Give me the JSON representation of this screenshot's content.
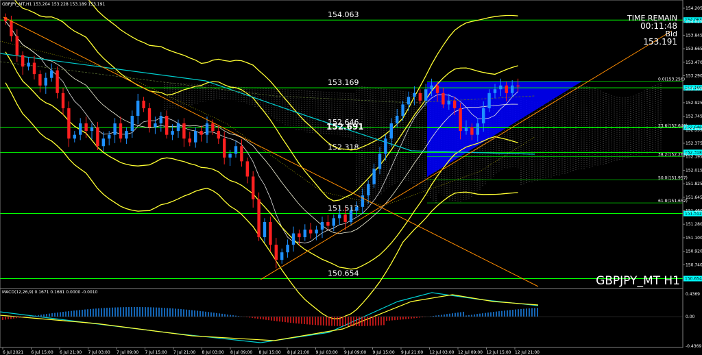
{
  "window": {
    "title": "GBPJPY_MT,H1 153.204 153.228 153.189 153.191",
    "symbol_label": "GBPJPY_MT H1"
  },
  "timer": {
    "label": "TIME REMAIN",
    "remaining": "00:11:48",
    "bid_label": "Bid",
    "bid": "153.191"
  },
  "price_axis": [
    "154.205",
    "154.025",
    "153.845",
    "153.665",
    "153.470",
    "153.290",
    "153.105",
    "152.925",
    "152.745",
    "152.555",
    "152.375",
    "152.195",
    "152.015",
    "151.825",
    "151.645",
    "151.460",
    "151.280",
    "151.100",
    "150.920",
    "150.740"
  ],
  "price_tags": [
    {
      "text": "154.063",
      "price": 154.063,
      "color": "#00ffff"
    },
    {
      "text": "153.169",
      "price": 153.169,
      "color": "#00ffff"
    },
    {
      "text": "152.646",
      "price": 152.646,
      "color": "#00ffff"
    },
    {
      "text": "152.318",
      "price": 152.318,
      "color": "#00ffff"
    },
    {
      "text": "151.512",
      "price": 151.512,
      "color": "#00ffff"
    },
    {
      "text": "150.654",
      "price": 150.654,
      "color": "#00ffff"
    }
  ],
  "levels": [
    {
      "text": "154.063",
      "price": 154.063,
      "color": "#00ff00"
    },
    {
      "text": "153.169",
      "price": 153.169,
      "color": "#00ff00"
    },
    {
      "text": "152.646",
      "price": 152.646,
      "color": "#00ff00"
    },
    {
      "text": "152.318",
      "price": 152.318,
      "color": "#00ff00"
    },
    {
      "text": "151.512",
      "price": 151.512,
      "color": "#00ff00"
    },
    {
      "text": "150.654",
      "price": 150.654,
      "color": "#00ff00"
    }
  ],
  "fibo": [
    {
      "text": "0.0(153.256)",
      "price": 153.256
    },
    {
      "text": "23.6(152.640)",
      "price": 152.64
    },
    {
      "text": "38.2(152.262)",
      "price": 152.262
    },
    {
      "text": "50.0(151.957)",
      "price": 151.957
    },
    {
      "text": "61.8(151.652)",
      "price": 151.652
    }
  ],
  "overlay_price": "152.691",
  "macd": {
    "header": "MACD(12,26,9) 0.1671 0.1681 0.0000 -0.0010",
    "axis": [
      "0.4369",
      "0.00",
      "-0.4369"
    ]
  },
  "time_axis": [
    "6 Jul 2021",
    "6 Jul 15:00",
    "6 Jul 21:00",
    "7 Jul 03:00",
    "7 Jul 09:00",
    "7 Jul 15:00",
    "7 Jul 21:00",
    "8 Jul 03:00",
    "8 Jul 09:00",
    "8 Jul 15:00",
    "8 Jul 21:00",
    "9 Jul 03:00",
    "9 Jul 09:00",
    "9 Jul 15:00",
    "9 Jul 21:00",
    "12 Jul 03:00",
    "12 Jul 09:00",
    "12 Jul 15:00",
    "12 Jul 21:00"
  ],
  "colors": {
    "bull": "#1e90ff",
    "bear": "#ff2020",
    "level": "#00ff00",
    "tag_bg": "#00ffff",
    "bands": "#ffff33",
    "trend": "#ff8c00",
    "ma": "#00cccc",
    "triangle": "#0000ff"
  },
  "chart_data": {
    "type": "candlestick",
    "symbol": "GBPJPY_MT",
    "timeframe": "H1",
    "ylim": [
      150.55,
      154.3
    ],
    "close_series": [
      154.05,
      153.85,
      153.6,
      153.45,
      153.5,
      153.35,
      153.2,
      153.3,
      153.4,
      153.1,
      152.9,
      152.5,
      152.55,
      152.7,
      152.6,
      152.65,
      152.4,
      152.5,
      152.55,
      152.7,
      152.5,
      152.6,
      152.8,
      153.0,
      152.9,
      152.65,
      152.7,
      152.8,
      152.55,
      152.6,
      152.7,
      152.5,
      152.45,
      152.6,
      152.55,
      152.7,
      152.6,
      152.5,
      152.25,
      152.3,
      152.4,
      152.2,
      152.0,
      151.7,
      151.2,
      151.4,
      151.1,
      150.9,
      151.0,
      151.1,
      151.25,
      151.2,
      151.3,
      151.25,
      151.3,
      151.4,
      151.35,
      151.45,
      151.5,
      151.4,
      151.55,
      151.6,
      151.75,
      151.9,
      152.1,
      152.3,
      152.5,
      152.7,
      152.8,
      152.95,
      153.05,
      153.1,
      153.0,
      153.15,
      153.2,
      153.1,
      152.95,
      153.0,
      152.9,
      152.6,
      152.65,
      152.55,
      152.7,
      152.9,
      153.1,
      153.15,
      153.2,
      153.1,
      153.2,
      153.19
    ],
    "levels": [
      154.063,
      153.169,
      152.646,
      152.318,
      151.512,
      150.654
    ],
    "macd": {
      "range": [
        -0.4369,
        0.4369
      ],
      "last_main": 0.1671,
      "last_signal": 0.1681
    }
  }
}
